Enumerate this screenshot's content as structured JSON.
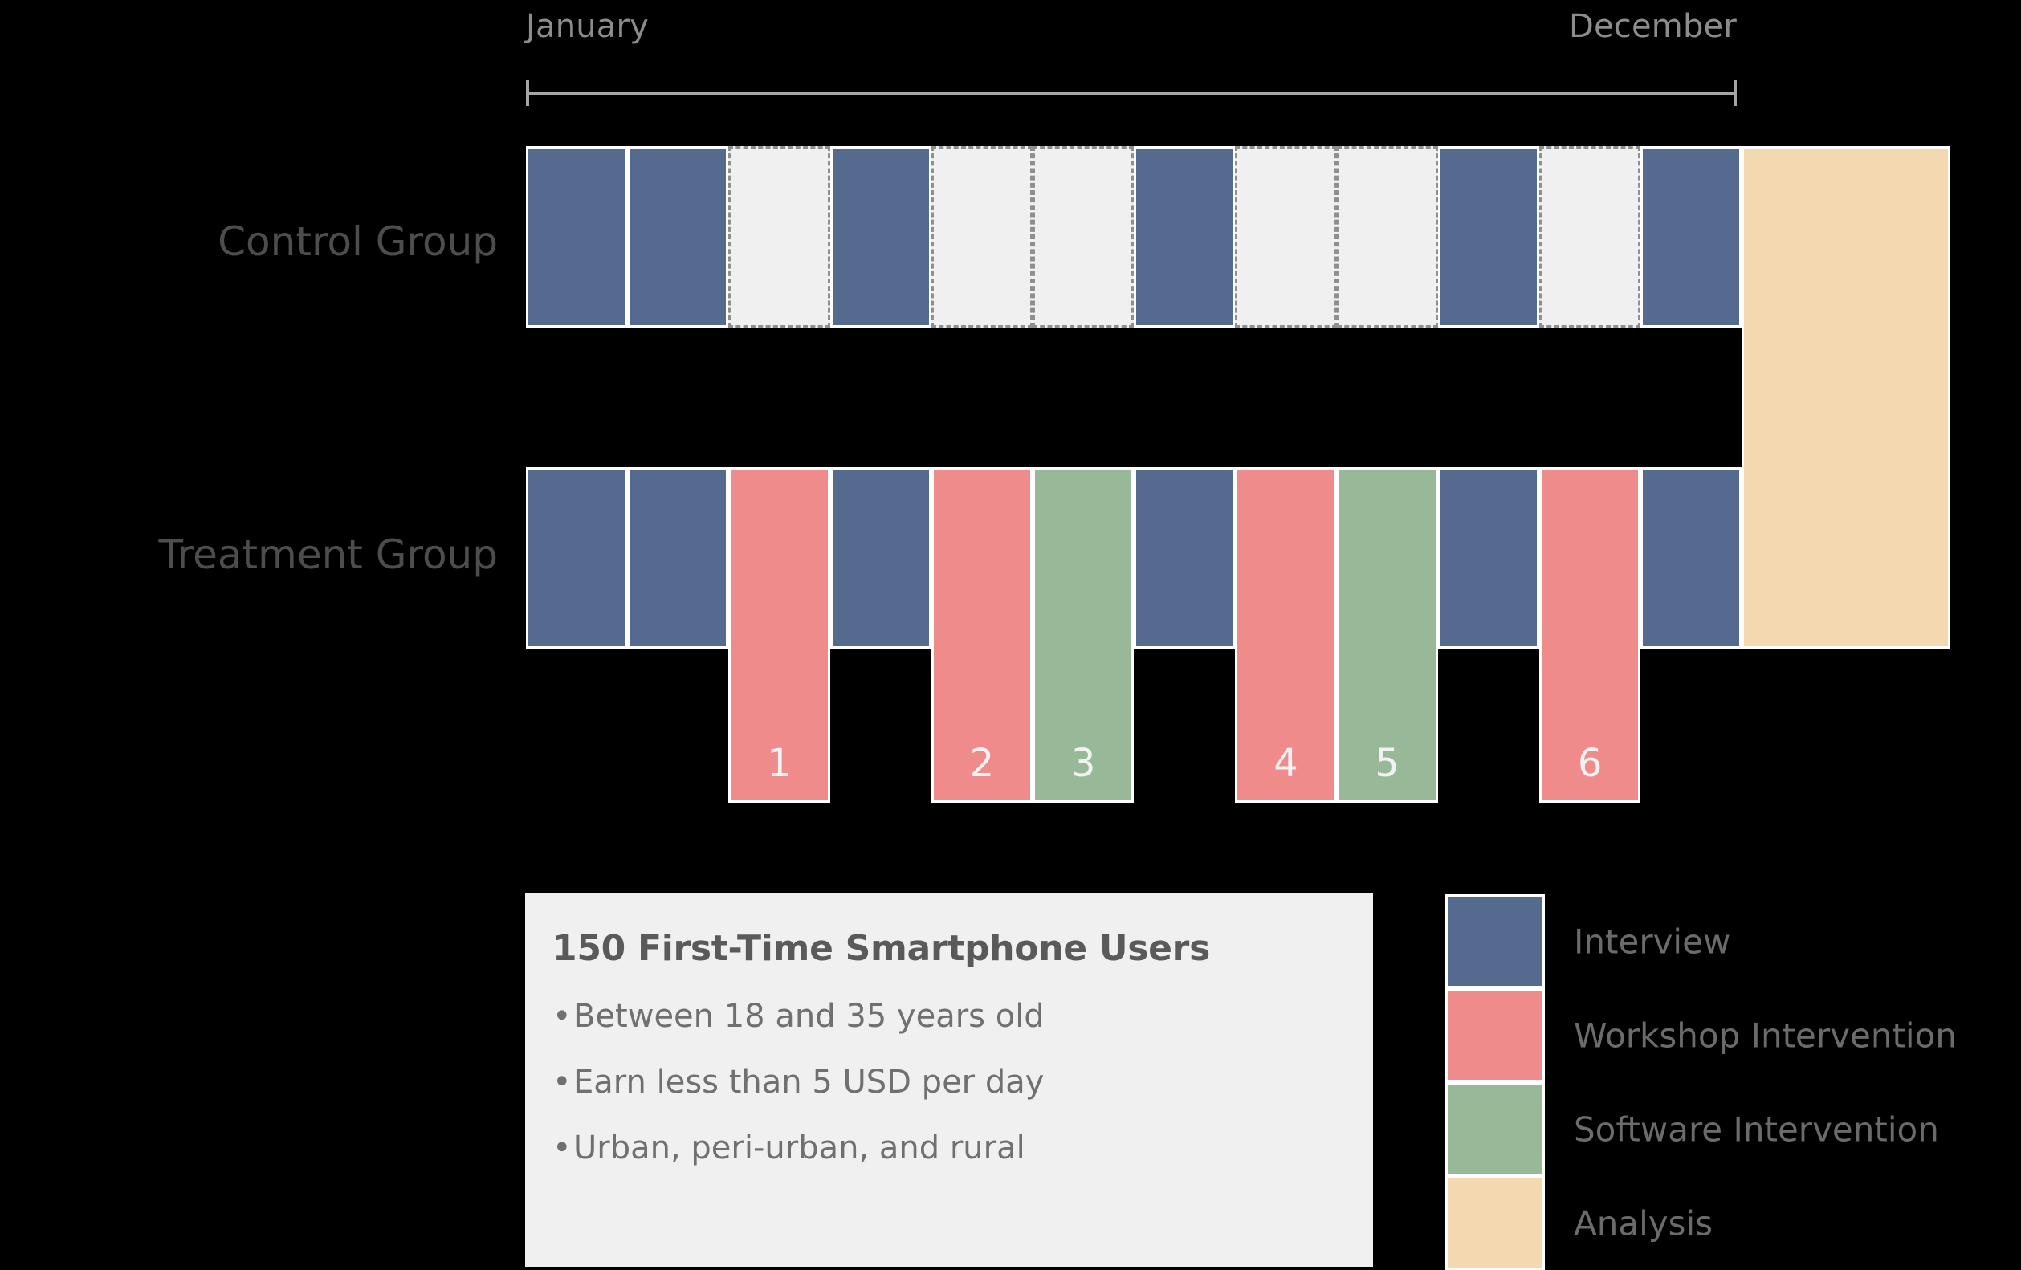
{
  "timeline": {
    "start_label": "January",
    "end_label": "December",
    "months": 12,
    "axis_x": 655,
    "axis_width": 1508
  },
  "rows": [
    {
      "key": "control",
      "label": "Control Group"
    },
    {
      "key": "treatment",
      "label": "Treatment Group"
    }
  ],
  "analysis": {
    "label": "Analysis",
    "color": "#f4d9b0"
  },
  "legend": {
    "items": [
      {
        "label": "Interview",
        "color": "#546b8f"
      },
      {
        "label": "Workshop Intervention",
        "color": "#ef8b8b"
      },
      {
        "label": "Software Intervention",
        "color": "#97b998"
      },
      {
        "label": "Analysis",
        "color": "#f4d9b0"
      }
    ]
  },
  "infobox": {
    "title": "150 First-Time Smartphone Users",
    "bullets": [
      "Between 18 and 35 years old",
      "Earn less than 5 USD per day",
      "Urban, peri-urban, and rural"
    ]
  },
  "colors": {
    "interview": "#546b8f",
    "workshop": "#ef8b8b",
    "software": "#97b998",
    "analysis": "#f4d9b0",
    "empty_fill": "#f0f0f0",
    "empty_border": "#8f8f8f",
    "background": "#000000",
    "border": "#ffffff",
    "text": "#6b6b6b",
    "infobox_bg": "#f0f0f0"
  },
  "chart_data": {
    "type": "bar",
    "title": "",
    "categories": [
      "1",
      "2",
      "3",
      "4",
      "5",
      "6",
      "7",
      "8",
      "9",
      "10",
      "11",
      "12"
    ],
    "series": [
      {
        "name": "Control Group",
        "values": [
          "interview",
          "interview",
          "empty",
          "interview",
          "empty",
          "empty",
          "interview",
          "empty",
          "empty",
          "interview",
          "empty",
          "interview"
        ]
      },
      {
        "name": "Treatment Group",
        "values": [
          "interview",
          "interview",
          "workshop",
          "interview",
          "workshop",
          "software",
          "interview",
          "workshop",
          "software",
          "interview",
          "workshop",
          "interview"
        ]
      }
    ],
    "annotations": [
      {
        "row": "treatment",
        "month": 3,
        "number": "1",
        "type": "workshop"
      },
      {
        "row": "treatment",
        "month": 5,
        "number": "2",
        "type": "workshop"
      },
      {
        "row": "treatment",
        "month": 6,
        "number": "3",
        "type": "software"
      },
      {
        "row": "treatment",
        "month": 8,
        "number": "4",
        "type": "workshop"
      },
      {
        "row": "treatment",
        "month": 9,
        "number": "5",
        "type": "software"
      },
      {
        "row": "treatment",
        "month": 11,
        "number": "6",
        "type": "workshop"
      }
    ]
  }
}
